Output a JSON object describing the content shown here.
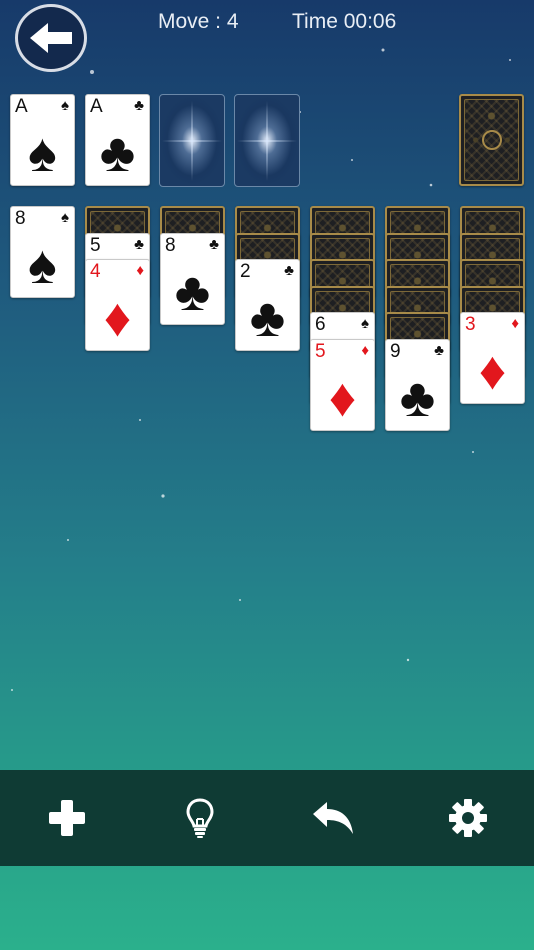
{
  "header": {
    "move_text": "Move : 4",
    "time_text": "Time 00:06"
  },
  "icons": {
    "back": "back-arrow-icon",
    "add": "plus-icon",
    "hint": "lightbulb-icon",
    "undo": "undo-icon",
    "settings": "gear-icon"
  },
  "foundations": [
    {
      "rank": "A",
      "suit": "♠",
      "color": "black"
    },
    {
      "rank": "A",
      "suit": "♣",
      "color": "black"
    },
    {
      "empty": true
    },
    {
      "empty": true
    }
  ],
  "tableau": [
    {
      "face_down": 0,
      "face_up": [
        {
          "rank": "8",
          "suit": "♠",
          "color": "black"
        }
      ]
    },
    {
      "face_down": 1,
      "face_up": [
        {
          "rank": "5",
          "suit": "♣",
          "color": "black"
        },
        {
          "rank": "4",
          "suit": "♦",
          "color": "red"
        }
      ]
    },
    {
      "face_down": 1,
      "face_up": [
        {
          "rank": "8",
          "suit": "♣",
          "color": "black"
        }
      ]
    },
    {
      "face_down": 2,
      "face_up": [
        {
          "rank": "2",
          "suit": "♣",
          "color": "black"
        }
      ]
    },
    {
      "face_down": 4,
      "face_up": [
        {
          "rank": "6",
          "suit": "♠",
          "color": "black"
        },
        {
          "rank": "5",
          "suit": "♦",
          "color": "red"
        }
      ]
    },
    {
      "face_down": 5,
      "face_up": [
        {
          "rank": "9",
          "suit": "♣",
          "color": "black"
        }
      ]
    },
    {
      "face_down": 4,
      "face_up": [
        {
          "rank": "3",
          "suit": "♦",
          "color": "red"
        }
      ]
    }
  ],
  "colors": {
    "toolbar_bg": "#0f3b34",
    "card_back_trim": "#a88b49",
    "red_suit": "#e2171d"
  }
}
